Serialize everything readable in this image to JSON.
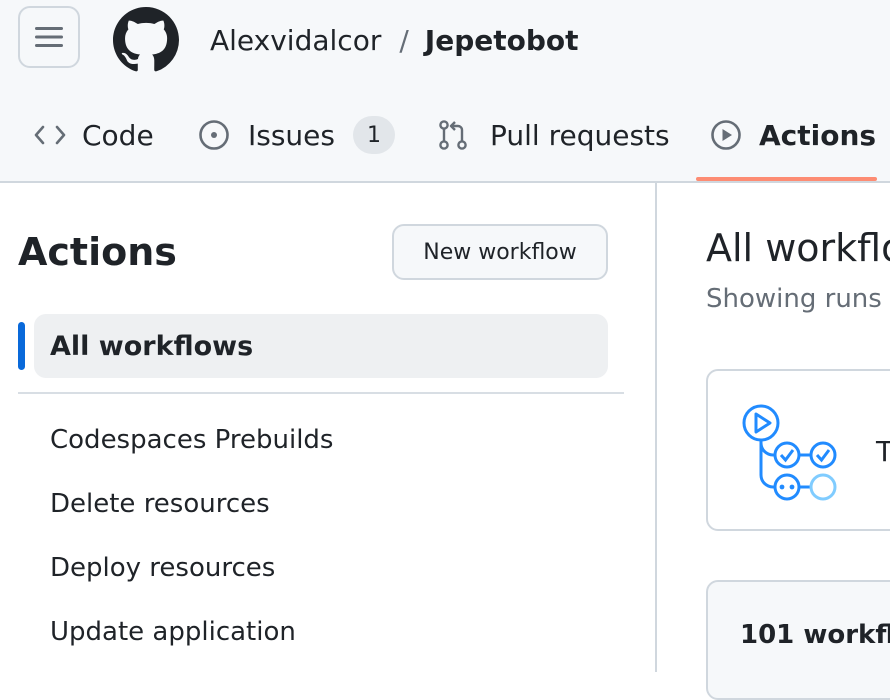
{
  "header": {
    "owner": "Alexvidalcor",
    "separator": "/",
    "repo": "Jepetobot"
  },
  "tabs": [
    {
      "label": "Code",
      "icon": "code-icon"
    },
    {
      "label": "Issues",
      "icon": "issue-opened-icon",
      "count": "1"
    },
    {
      "label": "Pull requests",
      "icon": "git-pull-request-icon"
    },
    {
      "label": "Actions",
      "icon": "play-icon",
      "selected": true
    }
  ],
  "sidebar": {
    "title": "Actions",
    "new_workflow_label": "New workflow",
    "active_item": "All workflows",
    "items": [
      {
        "label": "Codespaces Prebuilds"
      },
      {
        "label": "Delete resources"
      },
      {
        "label": "Deploy resources"
      },
      {
        "label": "Update application"
      }
    ]
  },
  "main": {
    "title": "All workflo",
    "subtitle": "Showing runs",
    "promo_text": "T",
    "runs_count": "101 workflo"
  },
  "colors": {
    "accent_blue": "#0969da",
    "tab_underline": "#fd8c73",
    "border": "#d0d7de",
    "muted_text": "#656d76"
  }
}
